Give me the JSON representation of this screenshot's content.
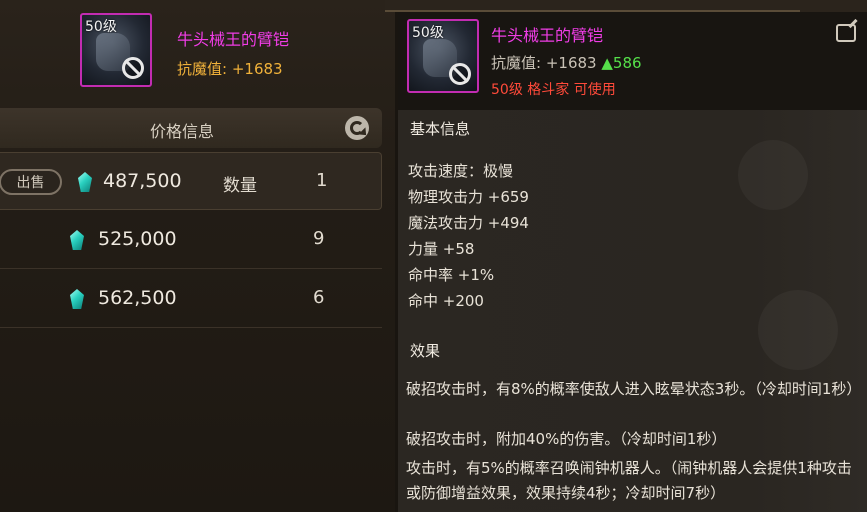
{
  "colors": {
    "epic_name": "#f03de6",
    "stat_value": "#f0b13a",
    "stat_increase": "#55e04a",
    "requirement": "#ff4a3a",
    "gem": "#2ad1c0"
  },
  "left_item": {
    "level": "50级",
    "name": "牛头械王的臂铠",
    "stat_label": "抗魔值:",
    "stat_value": "+1683",
    "slot_icon": "blocked-icon"
  },
  "price_panel": {
    "title": "价格信息",
    "refresh_icon": "refresh-icon",
    "sell_label": "出售",
    "quantity_label": "数量",
    "currency_icon": "gem-icon",
    "rows": [
      {
        "price": "487,500",
        "quantity": "1"
      },
      {
        "price": "525,000",
        "quantity": "9"
      },
      {
        "price": "562,500",
        "quantity": "6"
      }
    ]
  },
  "tooltip": {
    "level": "50级",
    "name": "牛头械王的臂铠",
    "stat_label": "抗魔值:",
    "stat_value": "+1683",
    "stat_increase": "▲586",
    "requirement": "50级 格斗家 可使用",
    "export_icon": "share-icon",
    "basic_title": "基本信息",
    "attributes": [
      "攻击速度：极慢",
      "物理攻击力 +659",
      "魔法攻击力 +494",
      "力量 +58",
      "命中率 +1%",
      "命中 +200"
    ],
    "effects_title": "效果",
    "effects": [
      "破招攻击时，有8%的概率使敌人进入眩晕状态3秒。（冷却时间1秒）",
      "破招攻击时，附加40%的伤害。（冷却时间1秒）",
      "攻击时，有5%的概率召唤闹钟机器人。（闹钟机器人会提供1种攻击或防御增益效果，效果持续4秒；冷却时间7秒）"
    ]
  }
}
